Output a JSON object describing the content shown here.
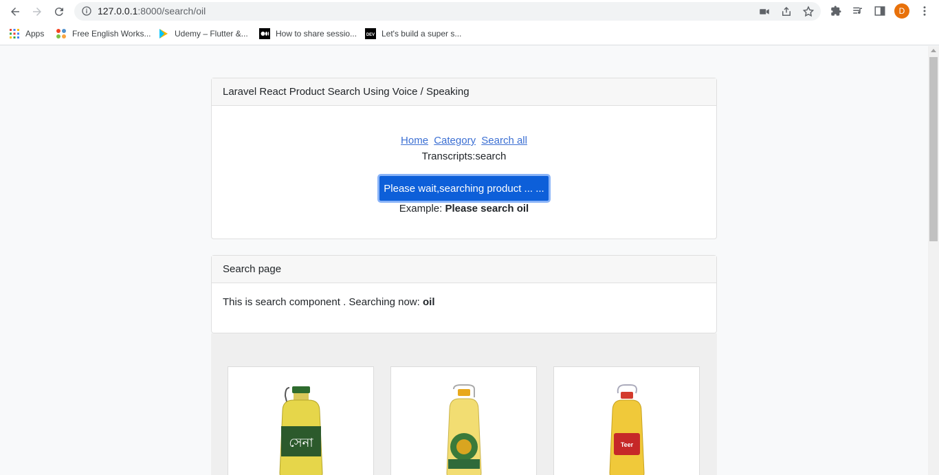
{
  "browser": {
    "url_host": "127.0.0.1",
    "url_path": ":8000/search/oil",
    "profile_initial": "D",
    "bookmarks": [
      {
        "label": "Apps",
        "icon": "apps-grid-icon"
      },
      {
        "label": "Free English Works...",
        "icon": "joomla-icon"
      },
      {
        "label": "Udemy – Flutter &...",
        "icon": "play-icon"
      },
      {
        "label": "How to share sessio...",
        "icon": "medium-icon"
      },
      {
        "label": "Let's build a super s...",
        "icon": "dev-icon"
      }
    ]
  },
  "voice_card": {
    "title": "Laravel React Product Search Using Voice / Speaking",
    "links": [
      "Home",
      "Category",
      "Search all"
    ],
    "transcript_label": "Transcripts:",
    "transcript_value": "search",
    "button_label": "Please wait,searching product ... ...",
    "example_label": "Example:",
    "example_value": "Please search oil"
  },
  "search_card": {
    "title": "Search page",
    "text": "This is search component . Searching now:",
    "query": "oil"
  },
  "products": [
    {
      "label_text": "সেনা",
      "icon": "oil-bottle-icon"
    },
    {
      "label_text": "",
      "icon": "oil-bottle-icon"
    },
    {
      "label_text": "Teer",
      "icon": "oil-bottle-icon"
    }
  ],
  "colors": {
    "primary_button": "#0d5fd9",
    "link": "#3b6fd3",
    "avatar": "#e8710a"
  }
}
